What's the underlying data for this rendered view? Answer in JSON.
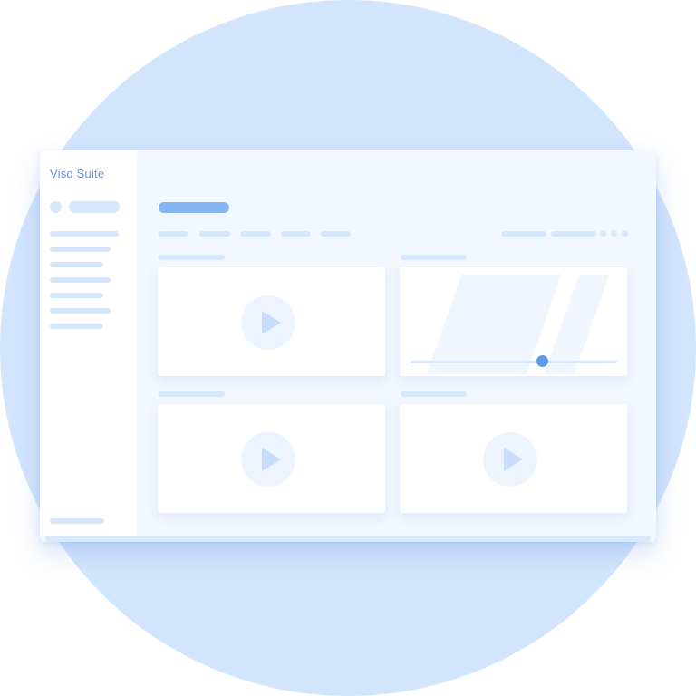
{
  "app": {
    "title": "Viso Suite"
  },
  "sidebar": {
    "nav_items": [
      {
        "id": "nav-1"
      },
      {
        "id": "nav-2"
      },
      {
        "id": "nav-3"
      },
      {
        "id": "nav-4"
      },
      {
        "id": "nav-5"
      },
      {
        "id": "nav-6"
      },
      {
        "id": "nav-7"
      }
    ]
  },
  "main": {
    "tabs": [
      "tab-1",
      "tab-2",
      "tab-3",
      "tab-4",
      "tab-5"
    ],
    "cards": [
      {
        "type": "video",
        "icon": "play-icon"
      },
      {
        "type": "video-scrubber",
        "slider_position": 0.64
      },
      {
        "type": "video",
        "icon": "play-icon"
      },
      {
        "type": "video",
        "icon": "play-icon"
      }
    ]
  },
  "colors": {
    "background_circle": "#d3e5fd",
    "accent": "#5c9be9",
    "accent_light": "#84b6f2",
    "placeholder": "#d6e6fc",
    "window_bg": "#f3f7fe",
    "card_bg": "#ffffff"
  }
}
